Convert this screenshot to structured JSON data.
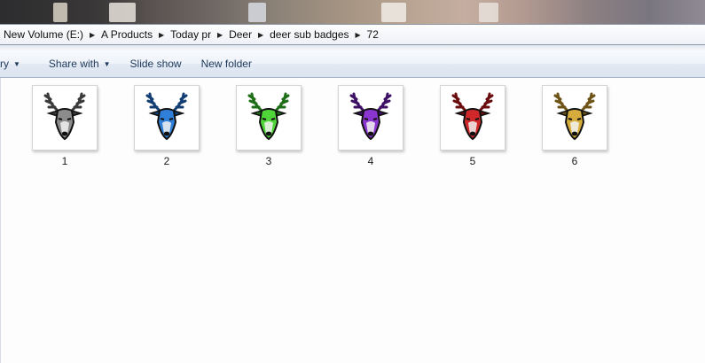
{
  "breadcrumb": [
    {
      "label": "New Volume (E:)"
    },
    {
      "label": "A Products"
    },
    {
      "label": "Today pr"
    },
    {
      "label": "Deer"
    },
    {
      "label": "deer sub badges"
    },
    {
      "label": "72"
    }
  ],
  "commandbar": {
    "partial_item": "ry",
    "share_with": "Share with",
    "slide_show": "Slide show",
    "new_folder": "New folder"
  },
  "files": [
    {
      "name": "1",
      "icon": "deer-badge-icon",
      "color": "#8c8c8c",
      "dark": "#3a3a3a"
    },
    {
      "name": "2",
      "icon": "deer-badge-icon",
      "color": "#2f7fd8",
      "dark": "#123e73"
    },
    {
      "name": "3",
      "icon": "deer-badge-icon",
      "color": "#4fd43a",
      "dark": "#1d6e16"
    },
    {
      "name": "4",
      "icon": "deer-badge-icon",
      "color": "#8a35cf",
      "dark": "#3d1066"
    },
    {
      "name": "5",
      "icon": "deer-badge-icon",
      "color": "#d0282a",
      "dark": "#6a0c0e"
    },
    {
      "name": "6",
      "icon": "deer-badge-icon",
      "color": "#d6ad3c",
      "dark": "#6d5316"
    }
  ]
}
